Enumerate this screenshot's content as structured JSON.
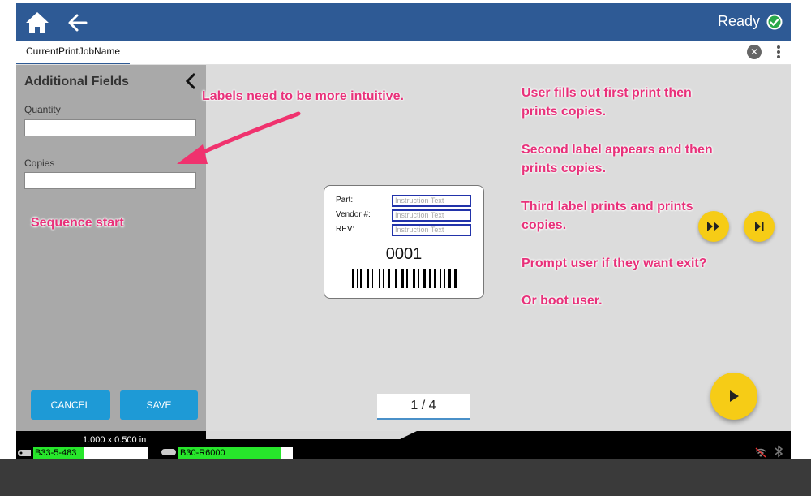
{
  "topbar": {
    "status_text": "Ready",
    "accent_color": "#2e5a95"
  },
  "tab": {
    "label": "CurrentPrintJobName"
  },
  "sidebar": {
    "title": "Additional Fields",
    "fields": [
      {
        "label": "Quantity",
        "value": ""
      },
      {
        "label": "Copies",
        "value": ""
      }
    ],
    "cancel_label": "CANCEL",
    "save_label": "SAVE"
  },
  "label_preview": {
    "rows": [
      {
        "label": "Part:",
        "placeholder": "Instruction Text"
      },
      {
        "label": "Vendor #:",
        "placeholder": "Instruction Text"
      },
      {
        "label": "REV:",
        "placeholder": "Instruction Text"
      }
    ],
    "number": "0001"
  },
  "pager": {
    "text": "1 / 4"
  },
  "statusbar": {
    "dimensions": "1.000 x 0.500 in",
    "label_cartridge": "B33-5-483",
    "ribbon": "B30-R6000",
    "label_level": 0.44,
    "ribbon_level": 0.9
  },
  "annotations": {
    "labels_note": "Labels need to be more intuitive.",
    "sequence_start": "Sequence start",
    "note1_line1": "User fills out first print then",
    "note1_line2": "prints copies.",
    "note2_line1": "Second label appears and then",
    "note2_line2": "prints copies.",
    "note3_line1": "Third label prints and prints",
    "note3_line2": "copies.",
    "note4": "Prompt user if they want exit?",
    "note5": "Or boot user.",
    "color": "#e8317a"
  }
}
